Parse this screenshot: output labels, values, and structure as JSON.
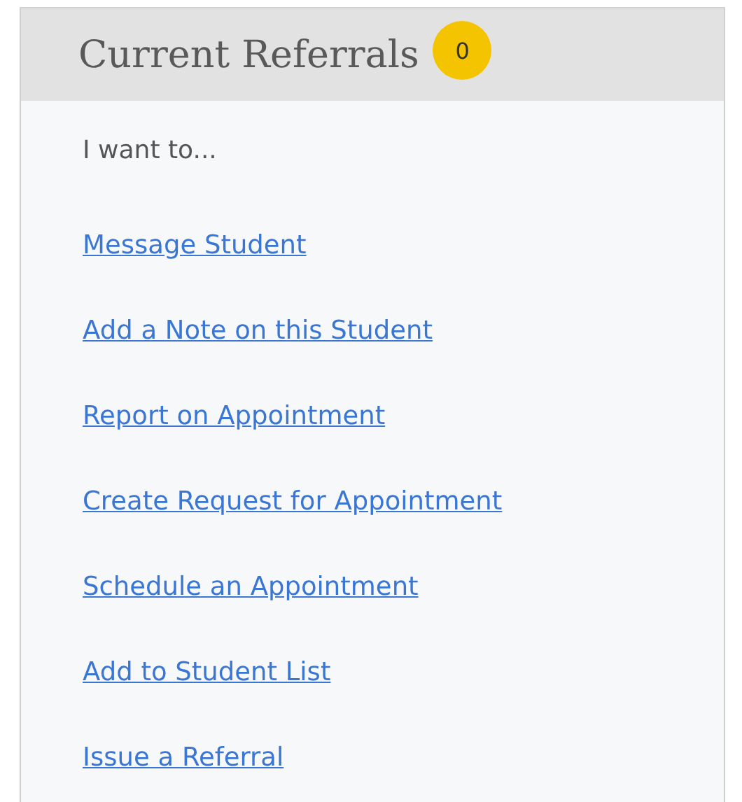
{
  "panel": {
    "title": "Current Referrals",
    "badge": "0",
    "intro": "I want to...",
    "links": [
      {
        "label": "Message Student"
      },
      {
        "label": "Add a Note on this Student"
      },
      {
        "label": "Report on Appointment"
      },
      {
        "label": "Create Request for Appointment"
      },
      {
        "label": "Schedule an Appointment"
      },
      {
        "label": "Add to Student List"
      },
      {
        "label": "Issue a Referral"
      }
    ]
  }
}
